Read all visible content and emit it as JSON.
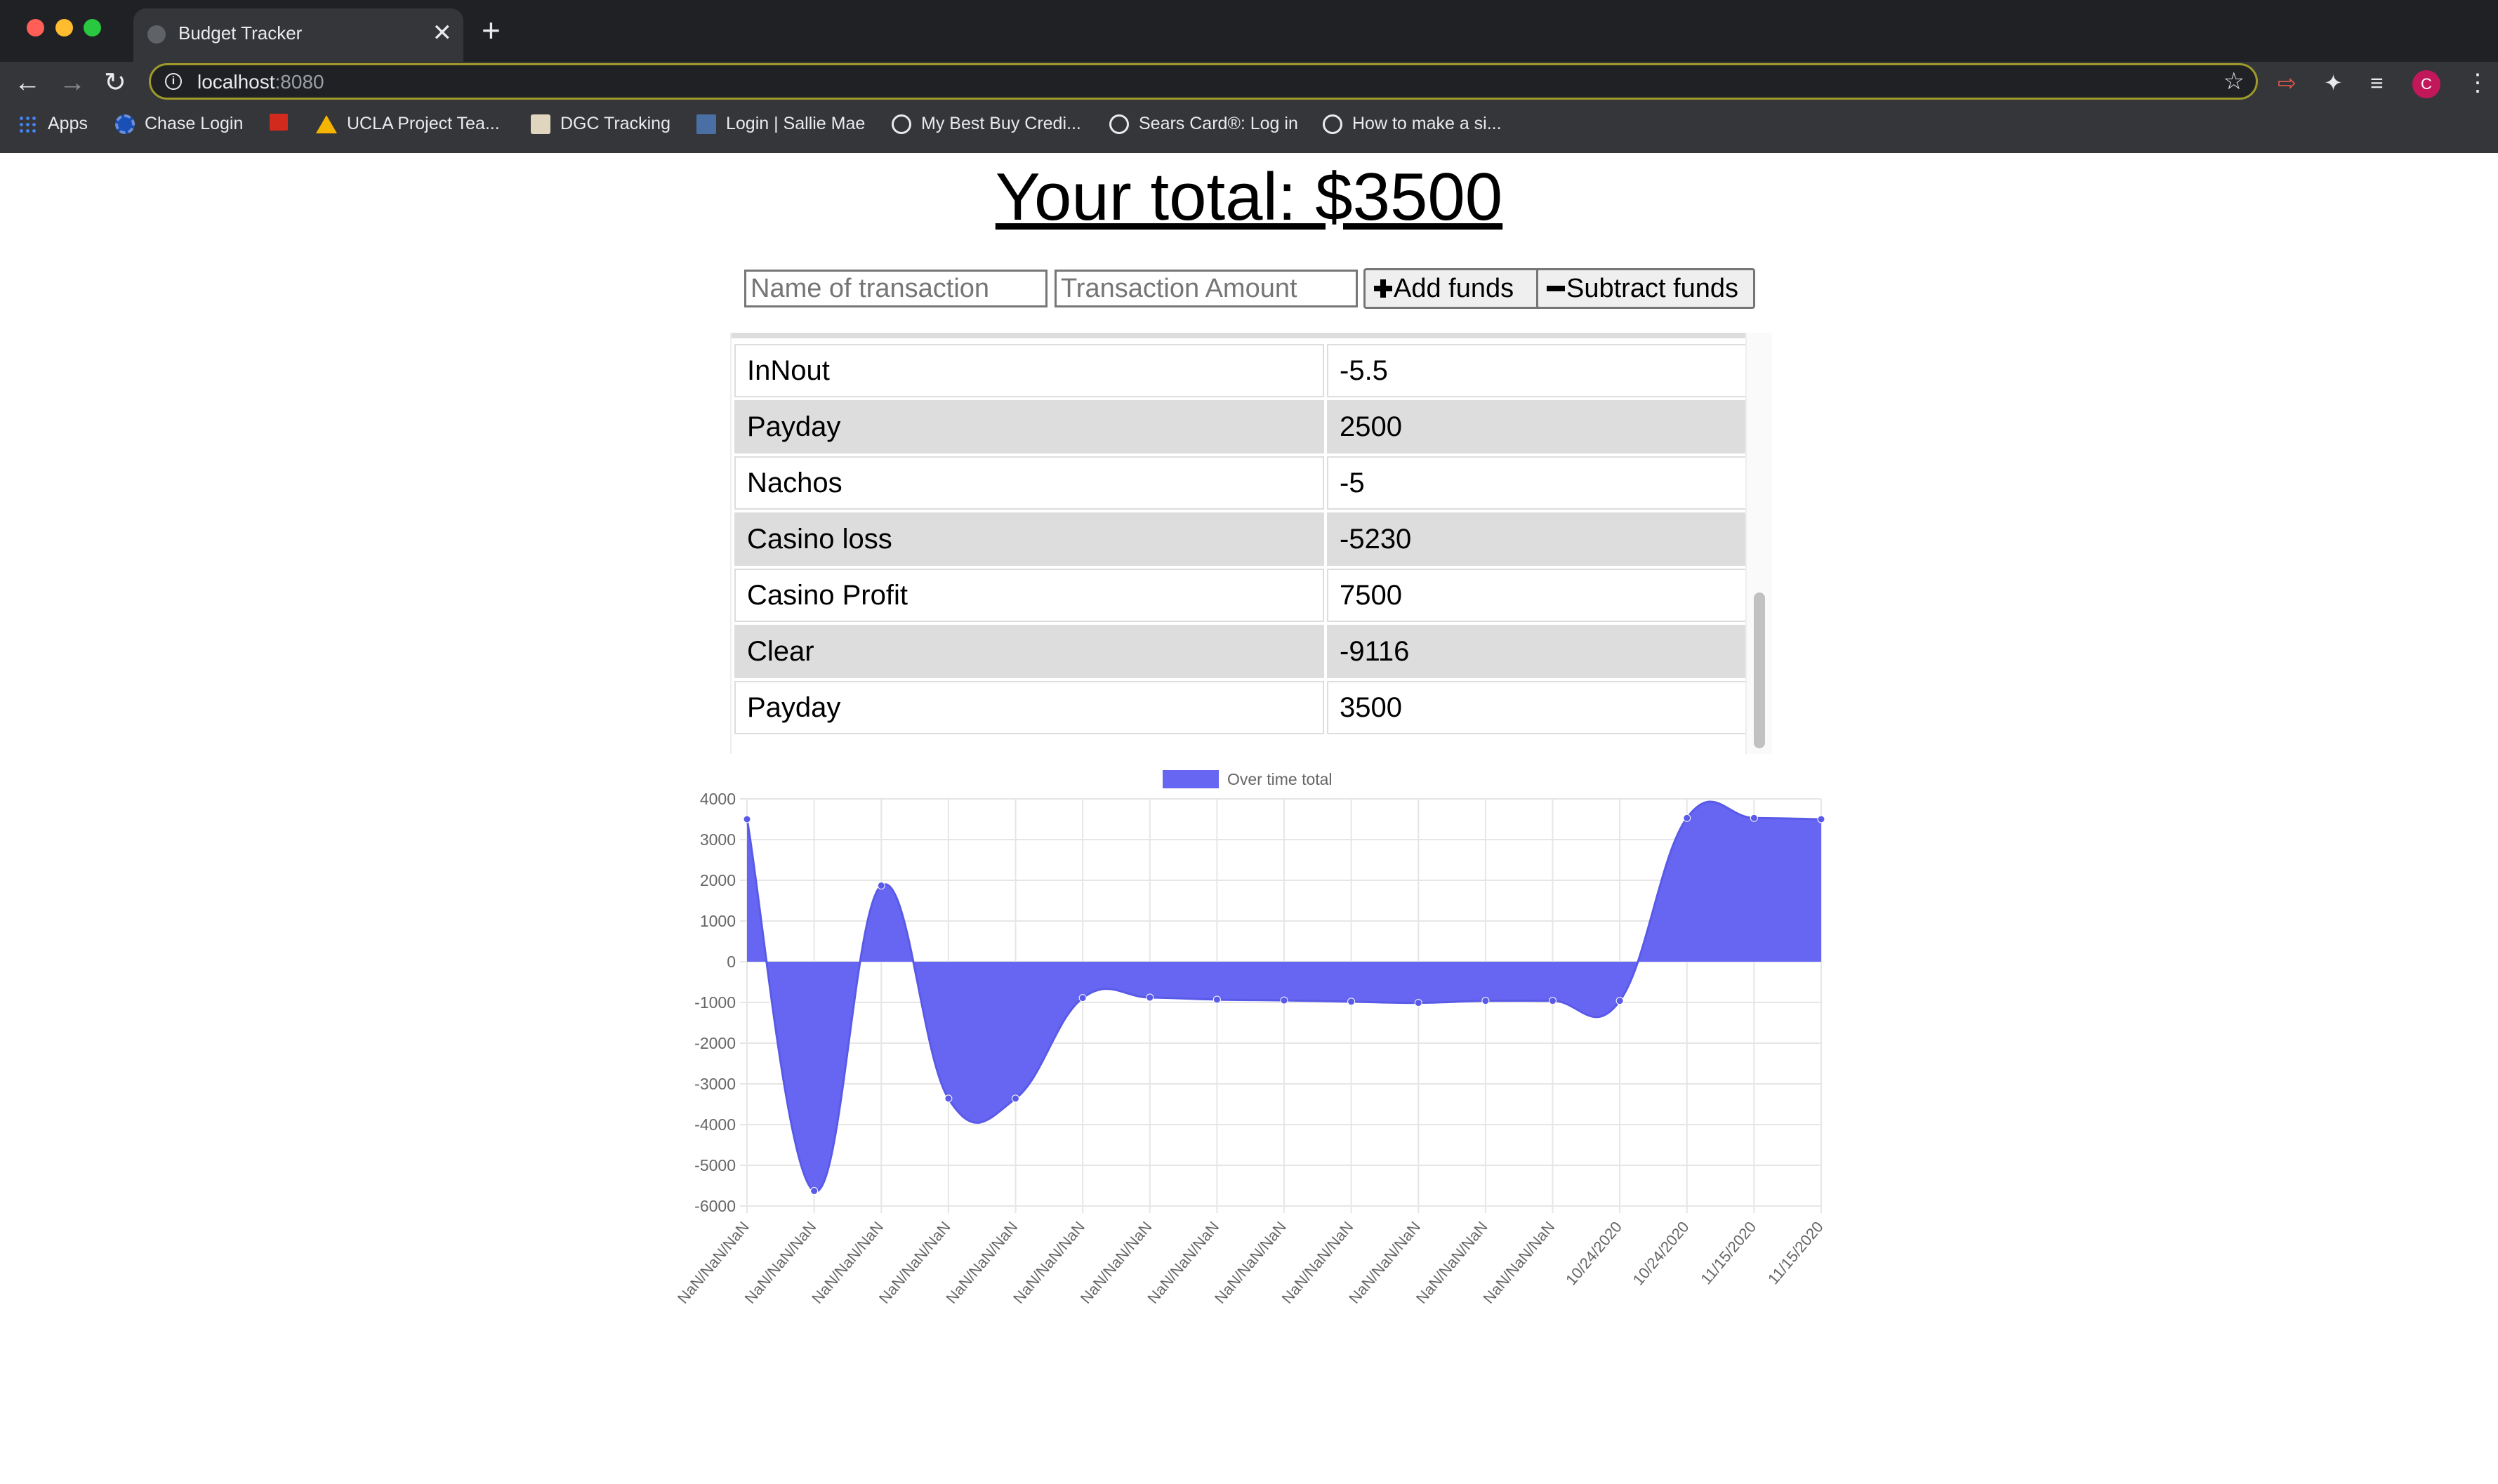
{
  "browser": {
    "tab_title": "Budget Tracker",
    "url_host": "localhost",
    "url_port": ":8080",
    "new_tab_symbol": "+",
    "close_symbol": "✕",
    "profile_initial": "C",
    "bookmarks": [
      {
        "label": "Apps",
        "icon": "apps-grid-icon"
      },
      {
        "label": "Chase Login",
        "icon": "chase-logo-icon"
      },
      {
        "label": "",
        "icon": "red-bookmark-icon"
      },
      {
        "label": "UCLA Project Tea...",
        "icon": "google-drive-icon"
      },
      {
        "label": "DGC Tracking",
        "icon": "dgc-icon"
      },
      {
        "label": "Login | Sallie Mae",
        "icon": "sallie-mae-icon"
      },
      {
        "label": "My Best Buy Credi...",
        "icon": "globe-icon"
      },
      {
        "label": "Sears Card®: Log in",
        "icon": "globe-icon"
      },
      {
        "label": "How to make a si...",
        "icon": "globe-icon"
      }
    ]
  },
  "page": {
    "title": "Your total: $3500",
    "name_placeholder": "Name of transaction",
    "amount_placeholder": "Transaction Amount",
    "add_label": "Add funds",
    "subtract_label": "Subtract funds",
    "add_icon": "plus-icon",
    "subtract_icon": "minus-icon"
  },
  "transactions": [
    {
      "name": "InNout",
      "amount": "-5.5"
    },
    {
      "name": "Payday",
      "amount": "2500"
    },
    {
      "name": "Nachos",
      "amount": "-5"
    },
    {
      "name": "Casino loss",
      "amount": "-5230"
    },
    {
      "name": "Casino Profit",
      "amount": "7500"
    },
    {
      "name": "Clear",
      "amount": "-9116"
    },
    {
      "name": "Payday",
      "amount": "3500"
    }
  ],
  "chart_data": {
    "type": "area",
    "colors": {
      "fill": "#6666f2",
      "grid": "#e6e6e6",
      "text": "#666666"
    },
    "legend_position": "top",
    "grid": true,
    "ylim": [
      -6000,
      4000
    ],
    "yticks": [
      4000,
      3000,
      2000,
      1000,
      0,
      -1000,
      -2000,
      -3000,
      -4000,
      -5000,
      -6000
    ],
    "categories": [
      "NaN/NaN/NaN",
      "NaN/NaN/NaN",
      "NaN/NaN/NaN",
      "NaN/NaN/NaN",
      "NaN/NaN/NaN",
      "NaN/NaN/NaN",
      "NaN/NaN/NaN",
      "NaN/NaN/NaN",
      "NaN/NaN/NaN",
      "NaN/NaN/NaN",
      "NaN/NaN/NaN",
      "NaN/NaN/NaN",
      "NaN/NaN/NaN",
      "10/24/2020",
      "10/24/2020",
      "11/15/2020",
      "11/15/2020"
    ],
    "series": [
      {
        "name": "Over time total",
        "values": [
          3500,
          -5630,
          1870,
          -3360,
          -3360,
          -890,
          -880,
          -930,
          -950,
          -980,
          -1010,
          -960,
          -960,
          -960,
          3530,
          3530,
          3500
        ]
      }
    ]
  }
}
